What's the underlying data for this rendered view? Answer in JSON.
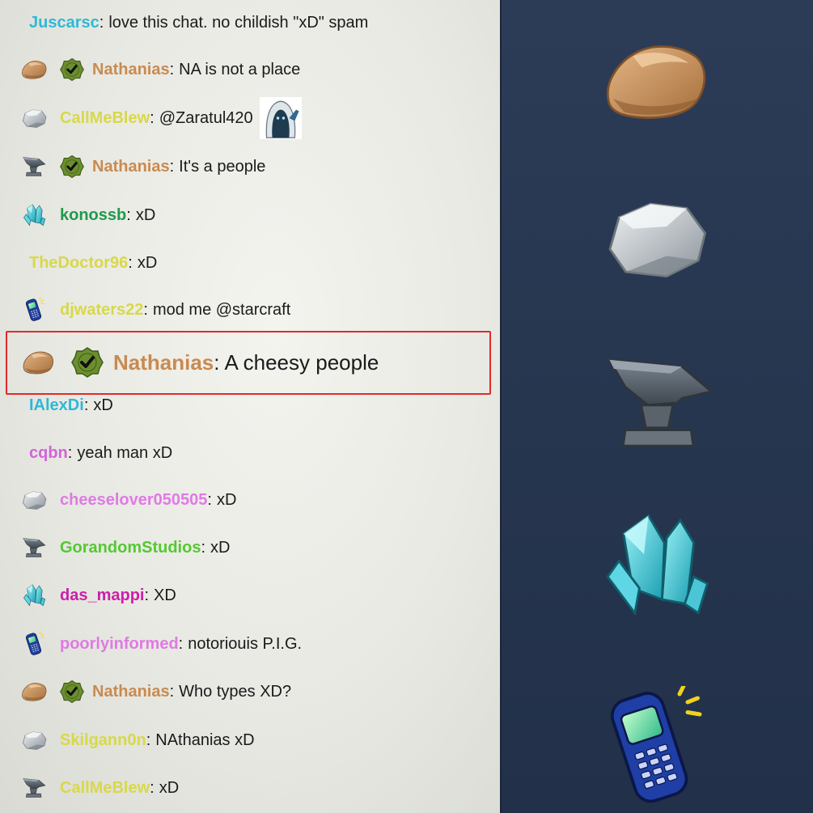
{
  "messages": [
    {
      "badge": "none",
      "mod": false,
      "user": "Juscarsc",
      "color": "#2fb8d6",
      "text": "love this chat. no childish \"xD\" spam"
    },
    {
      "badge": "rock",
      "mod": true,
      "user": "Nathanias",
      "color": "#c98a50",
      "text": "NA is not a place"
    },
    {
      "badge": "stone",
      "mod": false,
      "user": "CallMeBlew",
      "color": "#d8d84a",
      "text": "@Zaratul420",
      "emote": "ghost-wave-emote"
    },
    {
      "badge": "anvil",
      "mod": true,
      "user": "Nathanias",
      "color": "#c98a50",
      "text": "It's a people"
    },
    {
      "badge": "crystal",
      "mod": false,
      "user": "konossb",
      "color": "#1f9a4c",
      "text": "xD"
    },
    {
      "badge": "none",
      "mod": false,
      "user": "TheDoctor96",
      "color": "#d8d84a",
      "text": "xD"
    },
    {
      "badge": "phone",
      "mod": false,
      "user": "djwaters22",
      "color": "#d8d84a",
      "text": "mod me @starcraft"
    },
    {
      "badge": "rock",
      "mod": true,
      "user": "Nathanias",
      "color": "#c98a50",
      "text": "A cheesy people",
      "highlighted": true
    },
    {
      "badge": "none",
      "mod": false,
      "user": "IAlexDi",
      "color": "#2fb8d6",
      "text": "xD"
    },
    {
      "badge": "none",
      "mod": false,
      "user": "cqbn",
      "color": "#d462d8",
      "text": "yeah man xD"
    },
    {
      "badge": "stone",
      "mod": false,
      "user": "cheeselover050505",
      "color": "#e07ae3",
      "text": "xD"
    },
    {
      "badge": "anvil",
      "mod": false,
      "user": "GorandomStudios",
      "color": "#55c832",
      "text": "xD"
    },
    {
      "badge": "crystal",
      "mod": false,
      "user": "das_mappi",
      "color": "#cc1fa8",
      "text": "XD"
    },
    {
      "badge": "phone",
      "mod": false,
      "user": "poorlyinformed",
      "color": "#e07ae3",
      "text": "notoriouis P.I.G."
    },
    {
      "badge": "rock",
      "mod": true,
      "user": "Nathanias",
      "color": "#c98a50",
      "text": "Who types XD?"
    },
    {
      "badge": "stone",
      "mod": false,
      "user": "Skilgann0n",
      "color": "#d8d84a",
      "text": "NAthanias xD"
    },
    {
      "badge": "anvil",
      "mod": false,
      "user": "CallMeBlew",
      "color": "#d8d84a",
      "text": "xD"
    }
  ],
  "badge_tiers": [
    {
      "icon": "rock-badge-icon"
    },
    {
      "icon": "stone-badge-icon"
    },
    {
      "icon": "anvil-badge-icon"
    },
    {
      "icon": "crystal-badge-icon"
    },
    {
      "icon": "phone-badge-icon"
    }
  ],
  "colors": {
    "highlight_border": "#e12a2a",
    "mod_badge": "#6b8f2e",
    "right_panel_bg": "#2a3a55"
  }
}
